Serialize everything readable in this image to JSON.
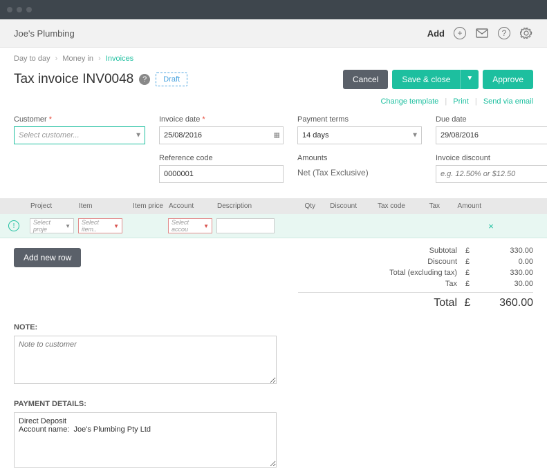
{
  "topbar": {
    "company": "Joe's Plumbing",
    "add": "Add"
  },
  "crumbs": {
    "a": "Day to day",
    "b": "Money in",
    "c": "Invoices"
  },
  "title": "Tax invoice INV0048",
  "badge": "Draft",
  "actions": {
    "cancel": "Cancel",
    "save": "Save & close",
    "approve": "Approve"
  },
  "links": {
    "template": "Change template",
    "print": "Print",
    "email": "Send via email"
  },
  "fields": {
    "customer": {
      "label": "Customer",
      "placeholder": "Select customer..."
    },
    "invoice_date": {
      "label": "Invoice date",
      "value": "25/08/2016"
    },
    "payment_terms": {
      "label": "Payment terms",
      "value": "14 days"
    },
    "due_date": {
      "label": "Due date",
      "value": "29/08/2016"
    },
    "ref": {
      "label": "Reference code",
      "value": "0000001"
    },
    "amounts": {
      "label": "Amounts",
      "value": "Net (Tax Exclusive)"
    },
    "discount": {
      "label": "Invoice discount",
      "placeholder": "e.g. 12.50% or $12.50"
    }
  },
  "cols": {
    "project": "Project",
    "item": "Item",
    "price": "Item price",
    "account": "Account",
    "desc": "Description",
    "qty": "Qty",
    "disc": "Discount",
    "taxcode": "Tax code",
    "tax": "Tax",
    "amount": "Amount"
  },
  "row": {
    "project": "Select proje",
    "item": "Select item..",
    "account": "Select accou"
  },
  "addrow": "Add new row",
  "totals": {
    "subtotal_l": "Subtotal",
    "subtotal_v": "330.00",
    "discount_l": "Discount",
    "discount_v": "0.00",
    "excl_l": "Total (excluding tax)",
    "excl_v": "330.00",
    "tax_l": "Tax",
    "tax_v": "30.00",
    "total_l": "Total",
    "total_v": "360.00",
    "cur": "£"
  },
  "note_lbl": "NOTE:",
  "note_ph": "Note to customer",
  "pay_lbl": "PAYMENT DETAILS:",
  "pay_val": "Direct Deposit\nAccount name:  Joe's Plumbing Pty Ltd"
}
